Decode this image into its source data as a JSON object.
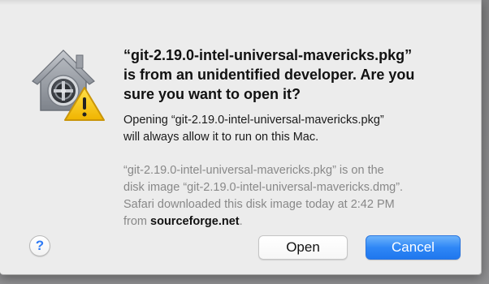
{
  "dialog": {
    "title_lines": [
      "“git-2.19.0-intel-universal-mavericks.pkg”",
      "is from an unidentified developer. Are you",
      "sure you want to open it?"
    ],
    "body_lines": [
      "Opening “git-2.19.0-intel-universal-mavericks.pkg”",
      "will always allow it to run on this Mac."
    ],
    "info_lines": [
      "“git-2.19.0-intel-universal-mavericks.pkg” is on the",
      "disk image “git-2.19.0-intel-universal-mavericks.dmg”.",
      "Safari downloaded this disk image today at 2:42 PM"
    ],
    "info_from_prefix": "from ",
    "info_source_link": "sourceforge.net",
    "info_suffix": ".",
    "help_glyph": "?",
    "open_label": "Open",
    "cancel_label": "Cancel",
    "icon": "gatekeeper-warning-icon"
  },
  "colors": {
    "accent": "#2f87f6",
    "warning": "#f5c400",
    "dialog_bg": "#ececec"
  }
}
